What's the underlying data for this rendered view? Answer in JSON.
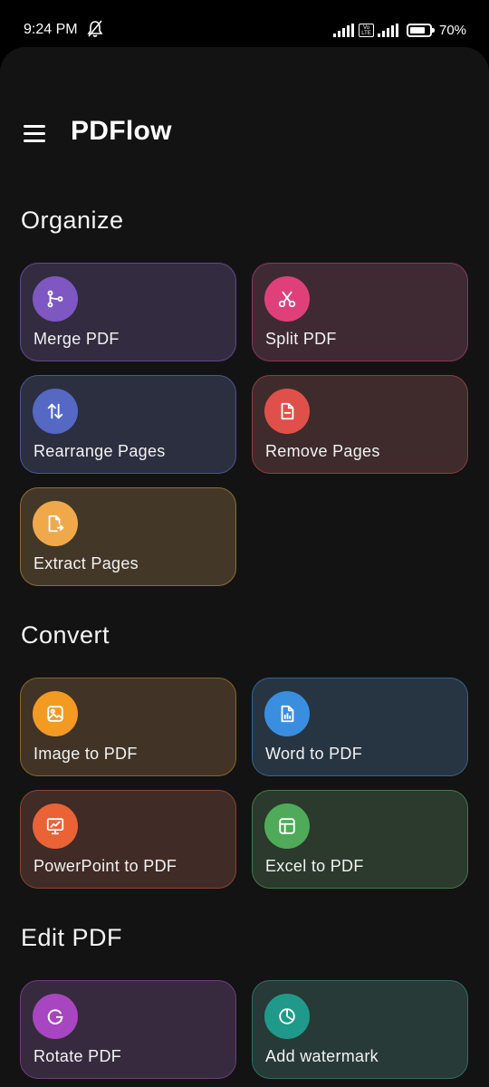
{
  "status_bar": {
    "time": "9:24 PM",
    "volte": "Vo LTE",
    "battery": "70%"
  },
  "header": {
    "title": "PDFlow"
  },
  "sections": [
    {
      "title": "Organize",
      "cards": [
        {
          "label": "Merge PDF",
          "icon": "merge-icon",
          "accent": "#7e57c2",
          "bg": "#332c40",
          "border": "#5d4b8c"
        },
        {
          "label": "Split PDF",
          "icon": "scissors-icon",
          "accent": "#e0407a",
          "bg": "#3f2a33",
          "border": "#8a3a55"
        },
        {
          "label": "Rearrange Pages",
          "icon": "swap-vertical-icon",
          "accent": "#5468c4",
          "bg": "#2c2f40",
          "border": "#4b5690"
        },
        {
          "label": "Remove Pages",
          "icon": "file-remove-icon",
          "accent": "#e0504a",
          "bg": "#3f2b2b",
          "border": "#8c3e3a"
        },
        {
          "label": "Extract Pages",
          "icon": "file-export-icon",
          "accent": "#f0a94a",
          "bg": "#433828",
          "border": "#8a6c3a"
        }
      ]
    },
    {
      "title": "Convert",
      "cards": [
        {
          "label": "Image to PDF",
          "icon": "image-icon",
          "accent": "#f39a23",
          "bg": "#413426",
          "border": "#8a6526"
        },
        {
          "label": "Word to PDF",
          "icon": "document-icon",
          "accent": "#3a8ee0",
          "bg": "#273542",
          "border": "#33648e"
        },
        {
          "label": "PowerPoint to PDF",
          "icon": "presentation-icon",
          "accent": "#ea6236",
          "bg": "#402b26",
          "border": "#8a4530"
        },
        {
          "label": "Excel to PDF",
          "icon": "table-icon",
          "accent": "#4faa5a",
          "bg": "#2b3a2c",
          "border": "#3f7a47"
        }
      ]
    },
    {
      "title": "Edit PDF",
      "cards": [
        {
          "label": "Rotate PDF",
          "icon": "rotate-icon",
          "accent": "#a845c0",
          "bg": "#372a3e",
          "border": "#6e3d80"
        },
        {
          "label": "Add watermark",
          "icon": "watermark-icon",
          "accent": "#1f9a8a",
          "bg": "#273a37",
          "border": "#2f6e66"
        }
      ]
    }
  ]
}
